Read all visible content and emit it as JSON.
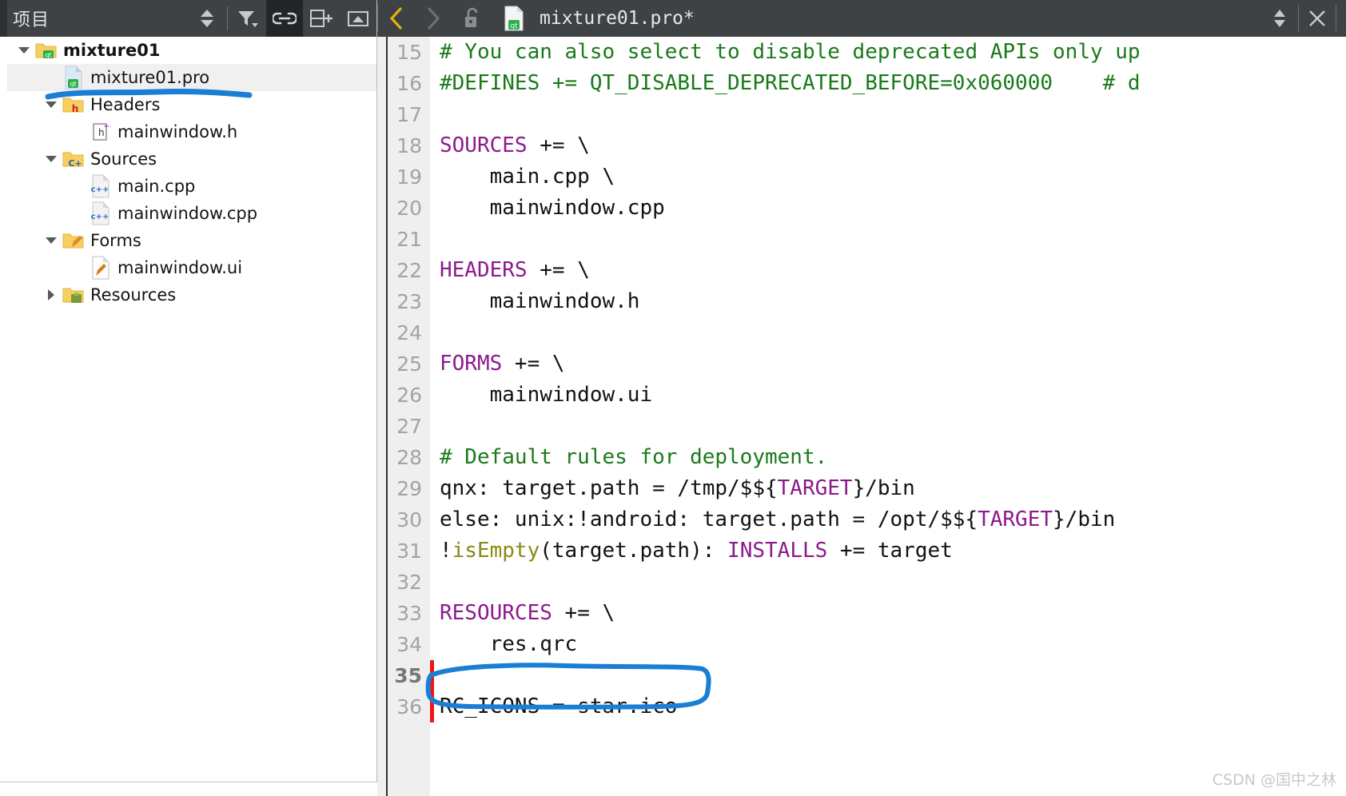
{
  "project_panel": {
    "title": "项目",
    "toolbar": [
      {
        "name": "sort-updown-icon",
        "label": ""
      },
      {
        "name": "filter-icon",
        "label": ""
      },
      {
        "name": "link-icon",
        "label": "",
        "active": true
      },
      {
        "name": "split-add-icon",
        "label": ""
      },
      {
        "name": "collapse-icon",
        "label": ""
      }
    ],
    "tree": [
      {
        "label": "mixture01",
        "indent": 0,
        "arrow": "down",
        "icon": "qt-folder-icon",
        "bold": true,
        "selected": false
      },
      {
        "label": "mixture01.pro",
        "indent": 1,
        "arrow": "none",
        "icon": "qt-pro-file-icon",
        "bold": false,
        "selected": true
      },
      {
        "label": "Headers",
        "indent": 1,
        "arrow": "down",
        "icon": "headers-folder-icon",
        "bold": false,
        "selected": false
      },
      {
        "label": "mainwindow.h",
        "indent": 2,
        "arrow": "none",
        "icon": "header-file-icon",
        "bold": false,
        "selected": false
      },
      {
        "label": "Sources",
        "indent": 1,
        "arrow": "down",
        "icon": "sources-folder-icon",
        "bold": false,
        "selected": false
      },
      {
        "label": "main.cpp",
        "indent": 2,
        "arrow": "none",
        "icon": "cpp-file-icon",
        "bold": false,
        "selected": false
      },
      {
        "label": "mainwindow.cpp",
        "indent": 2,
        "arrow": "none",
        "icon": "cpp-file-icon",
        "bold": false,
        "selected": false
      },
      {
        "label": "Forms",
        "indent": 1,
        "arrow": "down",
        "icon": "forms-folder-icon",
        "bold": false,
        "selected": false
      },
      {
        "label": "mainwindow.ui",
        "indent": 2,
        "arrow": "none",
        "icon": "ui-file-icon",
        "bold": false,
        "selected": false
      },
      {
        "label": "Resources",
        "indent": 1,
        "arrow": "right",
        "icon": "resources-folder-icon",
        "bold": false,
        "selected": false
      }
    ]
  },
  "editor": {
    "tab": {
      "filename": "mixture01.pro*",
      "back_label": "",
      "forward_label": "",
      "lock_label": "",
      "dropdown_label": "",
      "close_label": ""
    },
    "lines": [
      {
        "n": "15",
        "current": false,
        "marked": false,
        "spans": [
          {
            "t": "# You can also select to disable deprecated APIs only up",
            "c": "comment"
          }
        ]
      },
      {
        "n": "16",
        "current": false,
        "marked": false,
        "spans": [
          {
            "t": "#DEFINES += QT_DISABLE_DEPRECATED_BEFORE=0x060000    # d",
            "c": "comment"
          }
        ]
      },
      {
        "n": "17",
        "current": false,
        "marked": false,
        "spans": [
          {
            "t": "",
            "c": "plain"
          }
        ]
      },
      {
        "n": "18",
        "current": false,
        "marked": false,
        "spans": [
          {
            "t": "SOURCES",
            "c": "kw"
          },
          {
            "t": " += \\",
            "c": "plain"
          }
        ]
      },
      {
        "n": "19",
        "current": false,
        "marked": false,
        "spans": [
          {
            "t": "    main.cpp \\",
            "c": "plain"
          }
        ]
      },
      {
        "n": "20",
        "current": false,
        "marked": false,
        "spans": [
          {
            "t": "    mainwindow.cpp",
            "c": "plain"
          }
        ]
      },
      {
        "n": "21",
        "current": false,
        "marked": false,
        "spans": [
          {
            "t": "",
            "c": "plain"
          }
        ]
      },
      {
        "n": "22",
        "current": false,
        "marked": false,
        "spans": [
          {
            "t": "HEADERS",
            "c": "kw"
          },
          {
            "t": " += \\",
            "c": "plain"
          }
        ]
      },
      {
        "n": "23",
        "current": false,
        "marked": false,
        "spans": [
          {
            "t": "    mainwindow.h",
            "c": "plain"
          }
        ]
      },
      {
        "n": "24",
        "current": false,
        "marked": false,
        "spans": [
          {
            "t": "",
            "c": "plain"
          }
        ]
      },
      {
        "n": "25",
        "current": false,
        "marked": false,
        "spans": [
          {
            "t": "FORMS",
            "c": "kw"
          },
          {
            "t": " += \\",
            "c": "plain"
          }
        ]
      },
      {
        "n": "26",
        "current": false,
        "marked": false,
        "spans": [
          {
            "t": "    mainwindow.ui",
            "c": "plain"
          }
        ]
      },
      {
        "n": "27",
        "current": false,
        "marked": false,
        "spans": [
          {
            "t": "",
            "c": "plain"
          }
        ]
      },
      {
        "n": "28",
        "current": false,
        "marked": false,
        "spans": [
          {
            "t": "# Default rules for deployment.",
            "c": "comment"
          }
        ]
      },
      {
        "n": "29",
        "current": false,
        "marked": false,
        "spans": [
          {
            "t": "qnx: target.path = /tmp/$${",
            "c": "plain"
          },
          {
            "t": "TARGET",
            "c": "kw"
          },
          {
            "t": "}/bin",
            "c": "plain"
          }
        ]
      },
      {
        "n": "30",
        "current": false,
        "marked": false,
        "spans": [
          {
            "t": "else: unix:!android: target.path = /opt/$${",
            "c": "plain"
          },
          {
            "t": "TARGET",
            "c": "kw"
          },
          {
            "t": "}/bin",
            "c": "plain"
          }
        ]
      },
      {
        "n": "31",
        "current": false,
        "marked": false,
        "spans": [
          {
            "t": "!",
            "c": "plain"
          },
          {
            "t": "isEmpty",
            "c": "func"
          },
          {
            "t": "(target.path): ",
            "c": "plain"
          },
          {
            "t": "INSTALLS",
            "c": "kw"
          },
          {
            "t": " += target",
            "c": "plain"
          }
        ]
      },
      {
        "n": "32",
        "current": false,
        "marked": false,
        "spans": [
          {
            "t": "",
            "c": "plain"
          }
        ]
      },
      {
        "n": "33",
        "current": false,
        "marked": false,
        "spans": [
          {
            "t": "RESOURCES",
            "c": "kw"
          },
          {
            "t": " += \\",
            "c": "plain"
          }
        ]
      },
      {
        "n": "34",
        "current": false,
        "marked": false,
        "spans": [
          {
            "t": "    res.qrc",
            "c": "plain"
          }
        ]
      },
      {
        "n": "35",
        "current": true,
        "marked": true,
        "spans": [
          {
            "t": "",
            "c": "plain"
          }
        ]
      },
      {
        "n": "36",
        "current": false,
        "marked": true,
        "spans": [
          {
            "t": "RC_ICONS = star.ico",
            "c": "plain"
          }
        ]
      }
    ],
    "annotations": {
      "highlight_color": "#1a7fd4",
      "cursor_marker_color": "#f01515",
      "circled_text": "RC_ICONS = star.ico",
      "underlined_tree_item": "Headers"
    }
  },
  "watermark": "CSDN @国中之林"
}
